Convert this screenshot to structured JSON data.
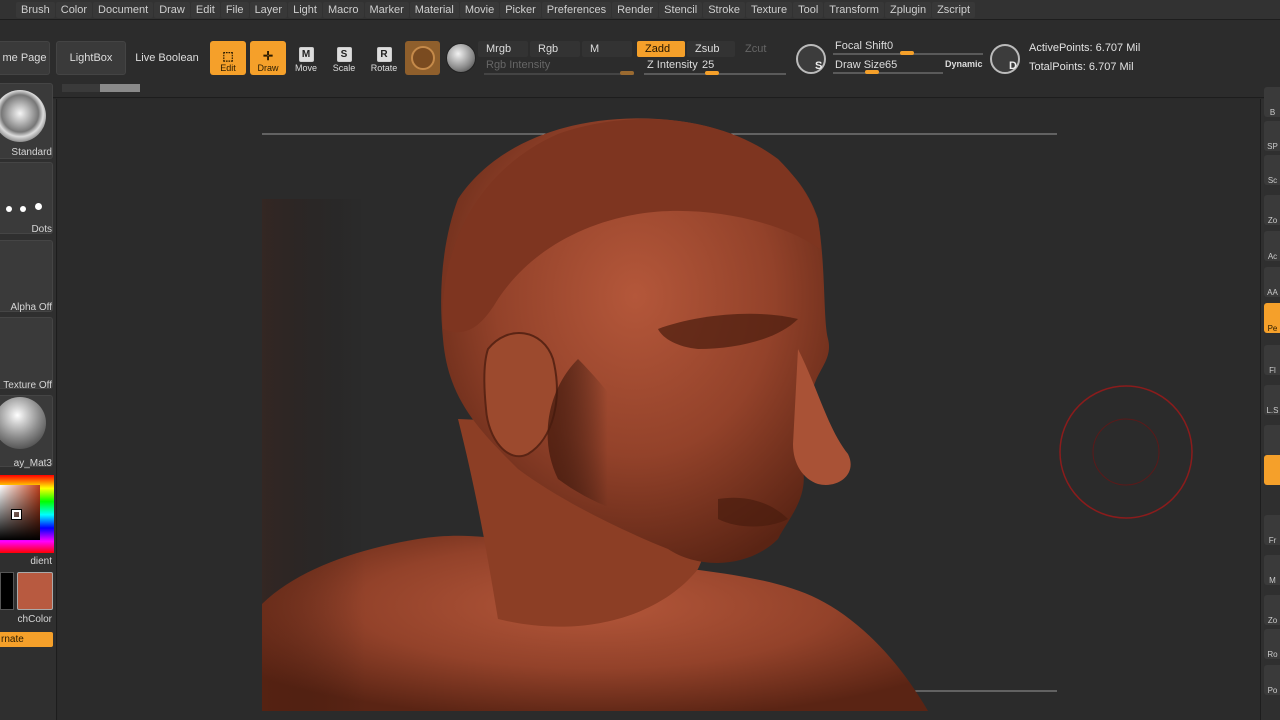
{
  "menu": [
    "Brush",
    "Color",
    "Document",
    "Draw",
    "Edit",
    "File",
    "Layer",
    "Light",
    "Macro",
    "Marker",
    "Material",
    "Movie",
    "Picker",
    "Preferences",
    "Render",
    "Stencil",
    "Stroke",
    "Texture",
    "Tool",
    "Transform",
    "Zplugin",
    "Zscript"
  ],
  "shelf": {
    "home_page": "me Page",
    "lightbox": "LightBox",
    "live_boolean": "Live Boolean",
    "tools": [
      {
        "label": "Edit",
        "key": "",
        "active": true
      },
      {
        "label": "Draw",
        "key": "",
        "active": true
      },
      {
        "label": "Move",
        "key": "M",
        "active": false
      },
      {
        "label": "Scale",
        "key": "S",
        "active": false
      },
      {
        "label": "Rotate",
        "key": "R",
        "active": false
      }
    ],
    "modes": {
      "mrgb": "Mrgb",
      "rgb": "Rgb",
      "m": "M",
      "zadd": "Zadd",
      "zsub": "Zsub",
      "zcut": "Zcut"
    },
    "rgb_intensity_label": "Rgb Intensity",
    "z_intensity_label": "Z Intensity",
    "z_intensity_value": "25",
    "focal_shift_label": "Focal Shift",
    "focal_shift_value": "0",
    "draw_size_label": "Draw Size",
    "draw_size_value": "65",
    "dynamic_label": "Dynamic",
    "s_key": "S",
    "d_key": "D",
    "active_points": "ActivePoints: 6.707 Mil",
    "total_points": "TotalPoints: 6.707 Mil"
  },
  "left_tray": {
    "brush_label": "Standard",
    "stroke_label": "Dots",
    "alpha_label": "Alpha Off",
    "texture_label": "Texture Off",
    "material_label": "ay_Mat3",
    "gradient_label": "dient",
    "switch_color_label": "chColor",
    "alternate_label": "rnate",
    "main_color": "#b85a40"
  },
  "right_strip": [
    "B",
    "SP",
    "Sc",
    "Zo",
    "Ac",
    "AA",
    "Pe",
    "Fl",
    "L.S",
    "",
    "",
    "Fr",
    "M",
    "Zo",
    "Ro",
    "Po"
  ],
  "colors": {
    "accent": "#f5a02a",
    "clay": "#a4492f",
    "cursor_ring": "#8a1c1c"
  }
}
